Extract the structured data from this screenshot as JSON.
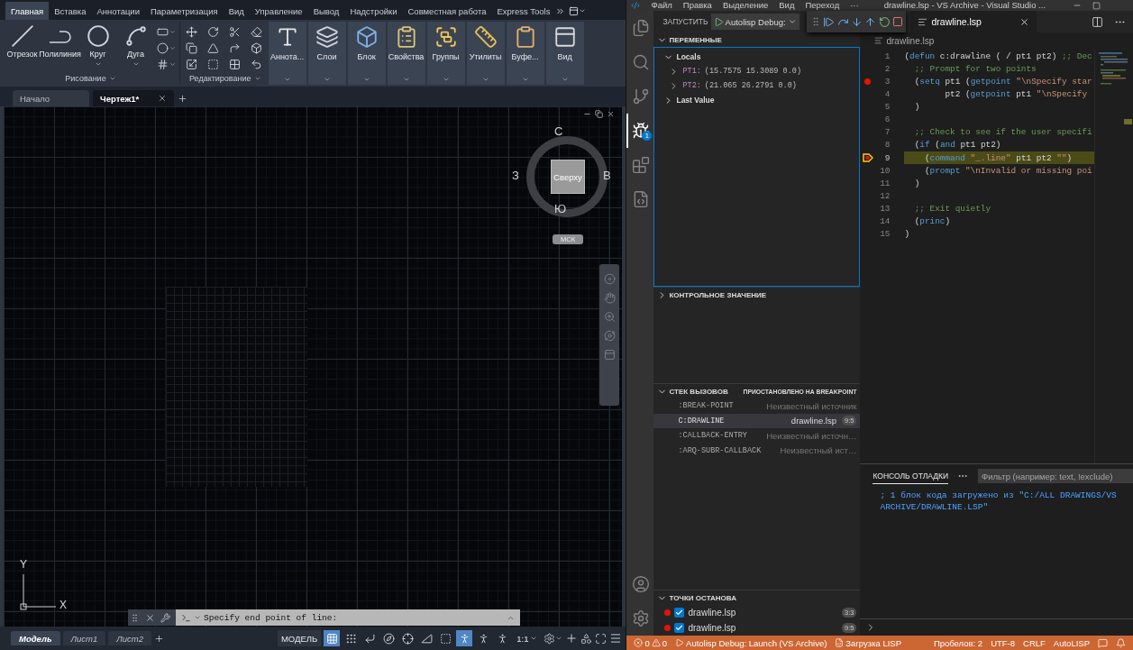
{
  "autocad": {
    "ribbon_tabs": [
      {
        "label": "Главная",
        "selected": true
      },
      {
        "label": "Вставка",
        "selected": false
      },
      {
        "label": "Аннотации",
        "selected": false
      },
      {
        "label": "Параметризация",
        "selected": false
      },
      {
        "label": "Вид",
        "selected": false
      },
      {
        "label": "Управление",
        "selected": false
      },
      {
        "label": "Вывод",
        "selected": false
      },
      {
        "label": "Надстройки",
        "selected": false
      },
      {
        "label": "Совместная работа",
        "selected": false
      },
      {
        "label": "Express Tools",
        "selected": false
      }
    ],
    "draw_tools": [
      {
        "label": "Отрезок",
        "dropdown": false
      },
      {
        "label": "Полилиния",
        "dropdown": false
      },
      {
        "label": "Круг",
        "dropdown": true
      },
      {
        "label": "Дуга",
        "dropdown": true
      }
    ],
    "panel_titles": [
      "Рисование",
      "Редактирование"
    ],
    "panels": [
      "Аннота...",
      "Слои",
      "Блок",
      "Свойства",
      "Группы",
      "Утилиты",
      "Буфе...",
      "Вид"
    ],
    "document_tabs": [
      {
        "label": "Начало",
        "selected": false
      },
      {
        "label": "Чертеж1*",
        "selected": true
      }
    ],
    "viewcube": {
      "north": "С",
      "west": "З",
      "east": "В",
      "south": "Ю",
      "face": "Сверху",
      "ucs": "МСК"
    },
    "axes": {
      "y": "Y",
      "x": "X"
    },
    "command_line": {
      "value": "Specify end point of line:"
    },
    "layout_tabs": [
      {
        "label": "Модель",
        "selected": true
      },
      {
        "label": "Лист1",
        "selected": false
      },
      {
        "label": "Лист2",
        "selected": false
      }
    ],
    "status_bar": {
      "space": "МОДЕЛЬ",
      "toggles": [
        {
          "on": true
        },
        {
          "on": false
        },
        {
          "on": false
        },
        {
          "on": false
        },
        {
          "on": false
        },
        {
          "on": false
        },
        {
          "on": false
        },
        {
          "on": true
        },
        {
          "on": false
        },
        {
          "on": false
        }
      ],
      "scale": "1:1"
    }
  },
  "vscode": {
    "title_bar": {
      "menu": [
        "Файл",
        "Правка",
        "Выделение",
        "Вид",
        "Переход",
        "···"
      ],
      "title": "drawline.lsp - VS Archive - Visual Studio ..."
    },
    "activity_bar": [
      {
        "selected": false
      },
      {
        "selected": false
      },
      {
        "selected": false
      },
      {
        "selected": true,
        "badge": "1"
      },
      {
        "selected": false
      },
      {
        "selected": false
      }
    ],
    "run_view": {
      "title": "ЗАПУСТИТЬ",
      "configuration": "Autolisp Debug:"
    },
    "variables": {
      "title": "ПЕРЕМЕННЫЕ",
      "expanded": true,
      "scopes": [
        {
          "label": "Locals",
          "expanded": true,
          "children": [
            {
              "name": "PT1:",
              "value": "(15.7575 15.3089 0.0)",
              "expanded": false
            },
            {
              "name": "PT2:",
              "value": "(21.065 26.2791 0.0)",
              "expanded": false
            }
          ]
        },
        {
          "label": "Last Value",
          "expanded": false
        }
      ]
    },
    "watch": {
      "title": "КОНТРОЛЬНОЕ ЗНАЧЕНИЕ",
      "expanded": false
    },
    "call_stack": {
      "title": "СТЕК ВЫЗОВОВ",
      "expanded": true,
      "status": "ПРИОСТАНОВЛЕНО НА BREAKPOINT",
      "frames": [
        {
          "name": ":BREAK-POINT",
          "source": "Неизвестный источник",
          "selected": false
        },
        {
          "name": "C:DRAWLINE",
          "source": "drawline.lsp",
          "position": "9:5",
          "selected": true
        },
        {
          "name": ":CALLBACK-ENTRY",
          "source": "Неизвестный источн…",
          "selected": false
        },
        {
          "name": ":ARQ-SUBR-CALLBACK",
          "source": "Неизвестный ист…",
          "selected": false
        }
      ]
    },
    "breakpoints": {
      "title": "ТОЧКИ ОСТАНОВА",
      "expanded": true,
      "items": [
        {
          "file": "drawline.lsp",
          "position": "3:3",
          "checked": true
        },
        {
          "file": "drawline.lsp",
          "position": "9:5",
          "checked": true
        }
      ]
    },
    "editor": {
      "tab": "drawline.lsp",
      "breadcrumb": "drawline.lsp",
      "lines": [
        {
          "number": "1",
          "breakpoint": false,
          "current": false,
          "tokens": [
            {
              "kind": "plain",
              "text": "("
            },
            {
              "kind": "keyword",
              "text": "defun"
            },
            {
              "kind": "plain",
              "text": " c:drawline ( / pt1 pt2) "
            },
            {
              "kind": "comment",
              "text": ";; Dec"
            }
          ]
        },
        {
          "number": "2",
          "breakpoint": false,
          "current": false,
          "tokens": [
            {
              "kind": "comment",
              "text": "  ;; Prompt for two points"
            }
          ]
        },
        {
          "number": "3",
          "breakpoint": true,
          "current": false,
          "tokens": [
            {
              "kind": "plain",
              "text": "  ("
            },
            {
              "kind": "keyword",
              "text": "setq"
            },
            {
              "kind": "plain",
              "text": " pt1 ("
            },
            {
              "kind": "keyword",
              "text": "getpoint"
            },
            {
              "kind": "string",
              "text": " \"\\nSpecify star"
            }
          ]
        },
        {
          "number": "4",
          "breakpoint": false,
          "current": false,
          "tokens": [
            {
              "kind": "plain",
              "text": "        pt2 ("
            },
            {
              "kind": "keyword",
              "text": "getpoint"
            },
            {
              "kind": "plain",
              "text": " pt1 "
            },
            {
              "kind": "string",
              "text": "\"\\nSpecify"
            }
          ]
        },
        {
          "number": "5",
          "breakpoint": false,
          "current": false,
          "tokens": [
            {
              "kind": "plain",
              "text": "  )"
            }
          ]
        },
        {
          "number": "6",
          "breakpoint": false,
          "current": false
        },
        {
          "number": "7",
          "breakpoint": false,
          "current": false,
          "tokens": [
            {
              "kind": "comment",
              "text": "  ;; Check to see if the user specifi"
            }
          ]
        },
        {
          "number": "8",
          "breakpoint": false,
          "current": false,
          "tokens": [
            {
              "kind": "plain",
              "text": "  ("
            },
            {
              "kind": "keyword",
              "text": "if"
            },
            {
              "kind": "plain",
              "text": " ("
            },
            {
              "kind": "keyword",
              "text": "and"
            },
            {
              "kind": "plain",
              "text": " pt1 pt2)"
            }
          ]
        },
        {
          "number": "9",
          "breakpoint": true,
          "current": true,
          "tokens": [
            {
              "kind": "plain",
              "text": "    ("
            },
            {
              "kind": "keyword",
              "text": "command"
            },
            {
              "kind": "string",
              "text": " \"_.line\""
            },
            {
              "kind": "plain",
              "text": " pt1 pt2 "
            },
            {
              "kind": "string",
              "text": "\"\""
            },
            {
              "kind": "plain",
              "text": ")"
            }
          ]
        },
        {
          "number": "10",
          "breakpoint": false,
          "current": false,
          "tokens": [
            {
              "kind": "plain",
              "text": "    ("
            },
            {
              "kind": "keyword",
              "text": "prompt"
            },
            {
              "kind": "string",
              "text": " \"\\nInvalid or missing poi"
            }
          ]
        },
        {
          "number": "11",
          "breakpoint": false,
          "current": false,
          "tokens": [
            {
              "kind": "plain",
              "text": "  )"
            }
          ]
        },
        {
          "number": "12",
          "breakpoint": false,
          "current": false
        },
        {
          "number": "13",
          "breakpoint": false,
          "current": false,
          "tokens": [
            {
              "kind": "comment",
              "text": "  ;; Exit quietly"
            }
          ]
        },
        {
          "number": "14",
          "breakpoint": false,
          "current": false,
          "tokens": [
            {
              "kind": "plain",
              "text": "  ("
            },
            {
              "kind": "keyword",
              "text": "princ"
            },
            {
              "kind": "plain",
              "text": ")"
            }
          ]
        },
        {
          "number": "15",
          "breakpoint": false,
          "current": false,
          "tokens": [
            {
              "kind": "plain",
              "text": ")"
            }
          ]
        }
      ]
    },
    "debug_console": {
      "tab": "КОНСОЛЬ ОТЛАДКИ",
      "filter_placeholder": "Фильтр (например: text, !exclude)",
      "output": "; 1 блок кода загружено из \"C:/ALL DRAWINGS/VS ARCHIVE/DRAWLINE.LSP\""
    },
    "status_bar": {
      "errors": "0",
      "warnings": "0",
      "debug_config": "Autolisp Debug: Launch (VS Archive)",
      "task": "Загрузка LISP",
      "items": [
        "Пробелов: 2",
        "UTF-8",
        "CRLF",
        "AutoLISP"
      ]
    }
  }
}
